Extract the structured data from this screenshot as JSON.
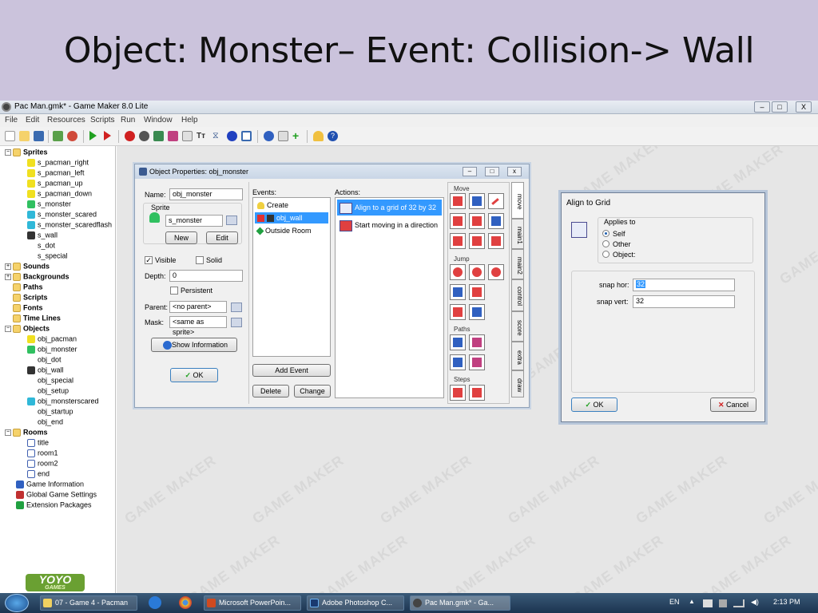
{
  "slide": {
    "title": "Object: Monster– Event: Collision-> Wall"
  },
  "window": {
    "title": "Pac Man.gmk* - Game Maker 8.0 Lite",
    "controls": {
      "minimize": "–",
      "restore": "□",
      "close": "X"
    }
  },
  "menu": [
    "File",
    "Edit",
    "Resources",
    "Scripts",
    "Run",
    "Window",
    "Help"
  ],
  "toolbar": {
    "icons": [
      "new-icon",
      "open-icon",
      "save-icon",
      "create-executable-icon",
      "publish-icon",
      "run-icon",
      "debug-icon",
      "add-sprite-icon",
      "add-sound-icon",
      "add-background-icon",
      "add-path-icon",
      "add-script-icon",
      "add-font-icon",
      "add-timeline-icon",
      "add-object-icon",
      "add-room-icon",
      "game-information-icon",
      "global-game-settings-icon",
      "extension-packages-icon",
      "upgrade-icon",
      "help-icon"
    ]
  },
  "tree": {
    "sprites": {
      "label": "Sprites",
      "items": [
        "s_pacman_right",
        "s_pacman_left",
        "s_pacman_up",
        "s_pacman_down",
        "s_monster",
        "s_monster_scared",
        "s_monster_scaredflash",
        "s_wall",
        "s_dot",
        "s_special"
      ]
    },
    "sounds": "Sounds",
    "backgrounds": "Backgrounds",
    "paths": "Paths",
    "scripts": "Scripts",
    "fonts": "Fonts",
    "timelines": "Time Lines",
    "objects": {
      "label": "Objects",
      "items": [
        "obj_pacman",
        "obj_monster",
        "obj_dot",
        "obj_wall",
        "obj_special",
        "obj_setup",
        "obj_monsterscared",
        "obj_startup",
        "obj_end"
      ]
    },
    "rooms": {
      "label": "Rooms",
      "items": [
        "title",
        "room1",
        "room2",
        "end"
      ]
    },
    "extras": [
      "Game Information",
      "Global Game Settings",
      "Extension Packages"
    ]
  },
  "logo": {
    "top": "YOYO",
    "bottom": "GAMES"
  },
  "watermark": "GAME MAKER",
  "object_window": {
    "title": "Object Properties: obj_monster",
    "name_label": "Name:",
    "name_value": "obj_monster",
    "sprite_label": "Sprite",
    "sprite_value": "s_monster",
    "new_button": "New",
    "edit_button": "Edit",
    "visible_label": "Visible",
    "visible_checked": true,
    "solid_label": "Solid",
    "solid_checked": false,
    "depth_label": "Depth:",
    "depth_value": "0",
    "persistent_label": "Persistent",
    "parent_label": "Parent:",
    "parent_value": "<no parent>",
    "mask_label": "Mask:",
    "mask_value": "<same as sprite>",
    "show_info_button": "Show Information",
    "ok_button": "OK",
    "events_label": "Events:",
    "events": [
      "Create",
      "obj_wall",
      "Outside Room"
    ],
    "selected_event": 1,
    "add_event_button": "Add Event",
    "delete_button": "Delete",
    "change_button": "Change",
    "actions_label": "Actions:",
    "actions": [
      "Align to a grid of 32 by 32",
      "Start moving in a direction"
    ],
    "selected_action": 0,
    "sections": [
      "Move",
      "Jump",
      "Paths",
      "Steps"
    ],
    "tabs": [
      "move",
      "main1",
      "main2",
      "control",
      "score",
      "extra",
      "draw"
    ],
    "active_tab": "move"
  },
  "align_dialog": {
    "title": "Align to Grid",
    "applies_to_label": "Applies to",
    "options": [
      "Self",
      "Other",
      "Object:"
    ],
    "selected_option": "Self",
    "snap_hor_label": "snap hor:",
    "snap_hor_value": "32",
    "snap_vert_label": "snap vert:",
    "snap_vert_value": "32",
    "ok_button": "OK",
    "cancel_button": "Cancel"
  },
  "taskbar": {
    "tasks": [
      "07 - Game 4 - Pacman",
      "Microsoft PowerPoin...",
      "Adobe Photoshop C...",
      "Pac Man.gmk* - Ga..."
    ],
    "language": "EN",
    "time": "2:13 PM"
  }
}
